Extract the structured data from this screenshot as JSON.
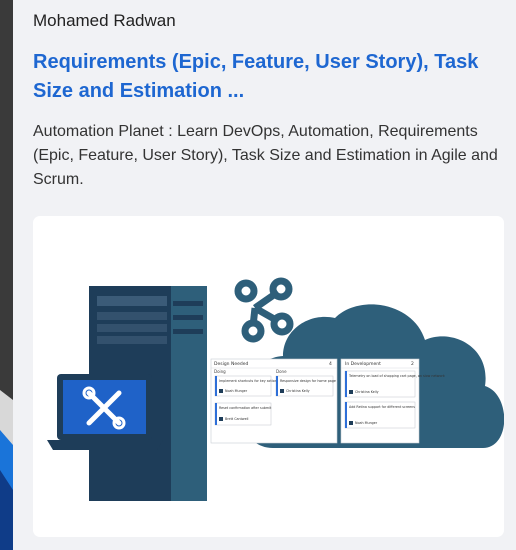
{
  "post": {
    "author": "Mohamed Radwan",
    "title": "Requirements (Epic, Feature, User Story), Task Size and Estimation ...",
    "description": "Automation Planet : Learn DevOps, Automation, Requirements (Epic, Feature, User Story), Task Size and Estimation in Agile and Scrum."
  },
  "thumbnail": {
    "board": {
      "panel_left_header": "Design Needed",
      "panel_left_count": "4",
      "col_doing": "Doing",
      "col_done": "Done",
      "panel_right_header": "In Development",
      "panel_right_count": "2",
      "cards": [
        {
          "text": "Implement shortcuts for key actions ...",
          "person": "Noah Munger"
        },
        {
          "text": "Reset confirmation after submit",
          "person": "Brett Cantwell"
        },
        {
          "text": "Responsive design for home page",
          "person": "Christina Kelly"
        },
        {
          "text": "Telemetry on load of shopping cart page, on slow network",
          "person": "Christina Kelly"
        },
        {
          "text": "Add Retina support for different screens",
          "person": "Noah Munger"
        }
      ]
    },
    "icons": [
      "server-icon",
      "laptop-icon",
      "tools-icon",
      "share-network-icon",
      "cloud-icon"
    ],
    "colors": {
      "navy": "#1e3d59",
      "teal": "#2e5f7a",
      "laptop_screen": "#1f62c8",
      "title_blue": "#1e67d1"
    }
  }
}
